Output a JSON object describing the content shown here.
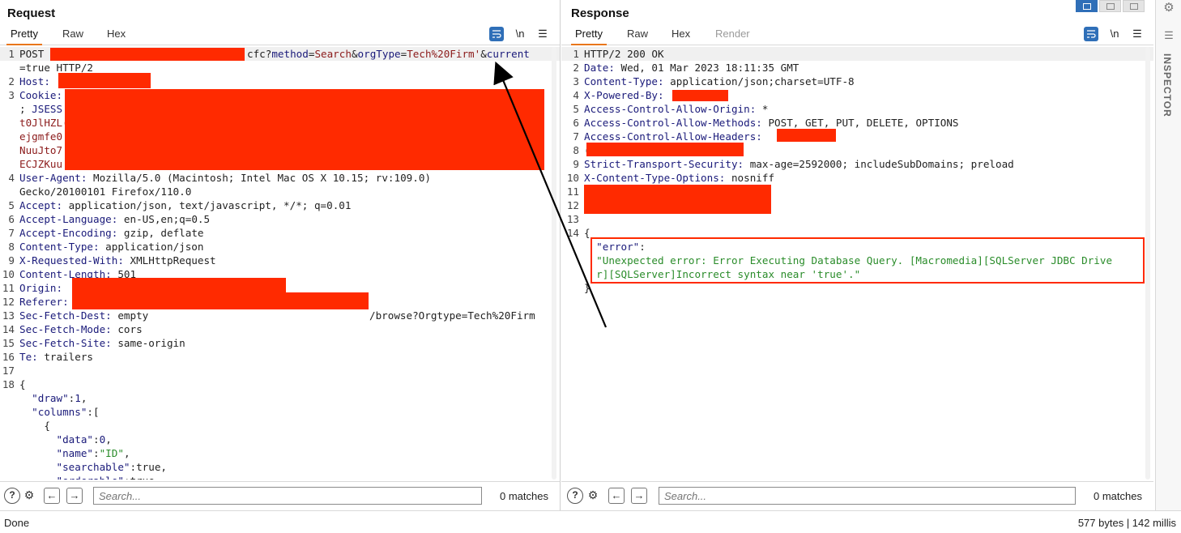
{
  "request": {
    "title": "Request",
    "tabs": [
      "Pretty",
      "Raw",
      "Hex"
    ],
    "active_tab": "Pretty",
    "newline_label": "\\n",
    "lines": [
      {
        "n": "1",
        "segs": [
          {
            "t": "POST ",
            "c": "plain"
          }
        ]
      },
      {
        "n": "",
        "segs": [
          {
            "t": "=true HTTP/2",
            "c": "plain"
          }
        ]
      },
      {
        "n": "2",
        "segs": [
          {
            "t": "Host:",
            "c": "k"
          }
        ]
      },
      {
        "n": "3",
        "segs": [
          {
            "t": "Cookie:",
            "c": "k"
          }
        ]
      },
      {
        "n": "",
        "segs": [
          {
            "t": "; ",
            "c": "plain"
          },
          {
            "t": "JSESS",
            "c": "sess"
          }
        ]
      },
      {
        "n": "",
        "segs": [
          {
            "t": "t0JlHZL(",
            "c": "cookie"
          }
        ]
      },
      {
        "n": "",
        "segs": [
          {
            "t": "ejgmfe0",
            "c": "cookie"
          }
        ]
      },
      {
        "n": "",
        "segs": [
          {
            "t": "NuuJto7",
            "c": "cookie"
          }
        ]
      },
      {
        "n": "",
        "segs": [
          {
            "t": "ECJZKuu",
            "c": "cookie"
          }
        ]
      },
      {
        "n": "4",
        "segs": [
          {
            "t": "User-Agent:",
            "c": "k"
          },
          {
            "t": " Mozilla/5.0 (Macintosh; Intel Mac OS X 10.15; rv:109.0)",
            "c": "plain"
          }
        ]
      },
      {
        "n": "",
        "segs": [
          {
            "t": "Gecko/20100101 Firefox/110.0",
            "c": "plain"
          }
        ]
      },
      {
        "n": "5",
        "segs": [
          {
            "t": "Accept:",
            "c": "k"
          },
          {
            "t": " application/json, text/javascript, */*; q=0.01",
            "c": "plain"
          }
        ]
      },
      {
        "n": "6",
        "segs": [
          {
            "t": "Accept-Language:",
            "c": "k"
          },
          {
            "t": " en-US,en;q=0.5",
            "c": "plain"
          }
        ]
      },
      {
        "n": "7",
        "segs": [
          {
            "t": "Accept-Encoding:",
            "c": "k"
          },
          {
            "t": " gzip, deflate",
            "c": "plain"
          }
        ]
      },
      {
        "n": "8",
        "segs": [
          {
            "t": "Content-Type:",
            "c": "k"
          },
          {
            "t": " application/json",
            "c": "plain"
          }
        ]
      },
      {
        "n": "9",
        "segs": [
          {
            "t": "X-Requested-With:",
            "c": "k"
          },
          {
            "t": " XMLHttpRequest",
            "c": "plain"
          }
        ]
      },
      {
        "n": "10",
        "segs": [
          {
            "t": "Content-Length:",
            "c": "k"
          },
          {
            "t": " 501",
            "c": "plain"
          }
        ]
      },
      {
        "n": "11",
        "segs": [
          {
            "t": "Origin:",
            "c": "k"
          }
        ]
      },
      {
        "n": "12",
        "segs": [
          {
            "t": "Referer:",
            "c": "k"
          }
        ]
      },
      {
        "n": "13",
        "segs": [
          {
            "t": "Sec-Fetch-Dest:",
            "c": "k"
          },
          {
            "t": " empty",
            "c": "plain"
          }
        ]
      },
      {
        "n": "14",
        "segs": [
          {
            "t": "Sec-Fetch-Mode:",
            "c": "k"
          },
          {
            "t": " cors",
            "c": "plain"
          }
        ]
      },
      {
        "n": "15",
        "segs": [
          {
            "t": "Sec-Fetch-Site:",
            "c": "k"
          },
          {
            "t": " same-origin",
            "c": "plain"
          }
        ]
      },
      {
        "n": "16",
        "segs": [
          {
            "t": "Te:",
            "c": "k"
          },
          {
            "t": " trailers",
            "c": "plain"
          }
        ]
      },
      {
        "n": "17",
        "segs": []
      },
      {
        "n": "18",
        "segs": [
          {
            "t": "{",
            "c": "plain"
          }
        ]
      },
      {
        "n": "",
        "segs": [
          {
            "t": "  \"draw\"",
            "c": "jk"
          },
          {
            "t": ":",
            "c": "plain"
          },
          {
            "t": "1",
            "c": "num"
          },
          {
            "t": ",",
            "c": "plain"
          }
        ]
      },
      {
        "n": "",
        "segs": [
          {
            "t": "  \"columns\"",
            "c": "jk"
          },
          {
            "t": ":[",
            "c": "plain"
          }
        ]
      },
      {
        "n": "",
        "segs": [
          {
            "t": "    {",
            "c": "plain"
          }
        ]
      },
      {
        "n": "",
        "segs": [
          {
            "t": "      \"data\"",
            "c": "jk"
          },
          {
            "t": ":",
            "c": "plain"
          },
          {
            "t": "0",
            "c": "num"
          },
          {
            "t": ",",
            "c": "plain"
          }
        ]
      },
      {
        "n": "",
        "segs": [
          {
            "t": "      \"name\"",
            "c": "jk"
          },
          {
            "t": ":",
            "c": "plain"
          },
          {
            "t": "\"ID\"",
            "c": "str"
          },
          {
            "t": ",",
            "c": "plain"
          }
        ]
      },
      {
        "n": "",
        "segs": [
          {
            "t": "      \"searchable\"",
            "c": "jk"
          },
          {
            "t": ":true,",
            "c": "plain"
          }
        ]
      },
      {
        "n": "",
        "segs": [
          {
            "t": "      \"orderable\"",
            "c": "jk"
          },
          {
            "t": ":true,",
            "c": "plain"
          }
        ]
      }
    ],
    "line1_tail": [
      {
        "t": "cfc?",
        "c": "plain"
      },
      {
        "t": "method",
        "c": "pn"
      },
      {
        "t": "=",
        "c": "plain"
      },
      {
        "t": "Search",
        "c": "pv"
      },
      {
        "t": "&",
        "c": "plain"
      },
      {
        "t": "orgType",
        "c": "pn"
      },
      {
        "t": "=",
        "c": "plain"
      },
      {
        "t": "Tech%20Firm'",
        "c": "pv"
      },
      {
        "t": "&",
        "c": "plain"
      },
      {
        "t": "current",
        "c": "pn"
      }
    ],
    "referer_tail": "/browse?Orgtype=Tech%20Firm",
    "search_placeholder": "Search...",
    "matches": "0 matches"
  },
  "response": {
    "title": "Response",
    "tabs": [
      "Pretty",
      "Raw",
      "Hex",
      "Render"
    ],
    "active_tab": "Pretty",
    "disabled_tab": "Render",
    "newline_label": "\\n",
    "lines": [
      {
        "n": "1",
        "segs": [
          {
            "t": "HTTP/2 200 OK",
            "c": "plain"
          }
        ]
      },
      {
        "n": "2",
        "segs": [
          {
            "t": "Date:",
            "c": "k"
          },
          {
            "t": " Wed, 01 Mar 2023 18:11:35 GMT",
            "c": "plain"
          }
        ]
      },
      {
        "n": "3",
        "segs": [
          {
            "t": "Content-Type:",
            "c": "k"
          },
          {
            "t": " application/json;charset=UTF-8",
            "c": "plain"
          }
        ]
      },
      {
        "n": "4",
        "segs": [
          {
            "t": "X-Powered-By:",
            "c": "k"
          }
        ]
      },
      {
        "n": "5",
        "segs": [
          {
            "t": "Access-Control-Allow-Origin:",
            "c": "k"
          },
          {
            "t": " *",
            "c": "plain"
          }
        ]
      },
      {
        "n": "6",
        "segs": [
          {
            "t": "Access-Control-Allow-Methods:",
            "c": "k"
          },
          {
            "t": " POST, GET, PUT, DELETE, OPTIONS",
            "c": "plain"
          }
        ]
      },
      {
        "n": "7",
        "segs": [
          {
            "t": "Access-Control-Allow-Headers:",
            "c": "k"
          }
        ]
      },
      {
        "n": "8",
        "segs": [
          {
            "t": "(",
            "c": "plain"
          }
        ]
      },
      {
        "n": "9",
        "segs": [
          {
            "t": "Strict-Transport-Security:",
            "c": "k"
          },
          {
            "t": " max-age=2592000; includeSubDomains; preload",
            "c": "plain"
          }
        ]
      },
      {
        "n": "10",
        "segs": [
          {
            "t": "X-Content-Type-Options:",
            "c": "k"
          },
          {
            "t": " nosniff",
            "c": "plain"
          }
        ]
      },
      {
        "n": "11",
        "segs": []
      },
      {
        "n": "12",
        "segs": []
      },
      {
        "n": "13",
        "segs": []
      },
      {
        "n": "14",
        "segs": [
          {
            "t": "{",
            "c": "plain"
          }
        ]
      },
      {
        "n": "",
        "segs": [
          {
            "t": "  \"error\"",
            "c": "jk"
          },
          {
            "t": ":",
            "c": "plain"
          }
        ]
      },
      {
        "n": "",
        "segs": [
          {
            "t": "  \"Unexpected error: Error Executing Database Query. [Macromedia][SQLServer JDBC Drive",
            "c": "str"
          }
        ]
      },
      {
        "n": "",
        "segs": [
          {
            "t": "  r][SQLServer]Incorrect syntax near 'true'.\"",
            "c": "str"
          }
        ]
      },
      {
        "n": "",
        "segs": [
          {
            "t": "}",
            "c": "plain"
          }
        ]
      }
    ],
    "search_placeholder": "Search...",
    "matches": "0 matches"
  },
  "status": {
    "left": "Done",
    "right": "577 bytes | 142 millis"
  },
  "inspector": {
    "label": "INSPECTOR"
  },
  "colors": {
    "redaction": "#ff2a00",
    "accent": "#2f6fb8",
    "tab_underline": "#e8761b"
  }
}
